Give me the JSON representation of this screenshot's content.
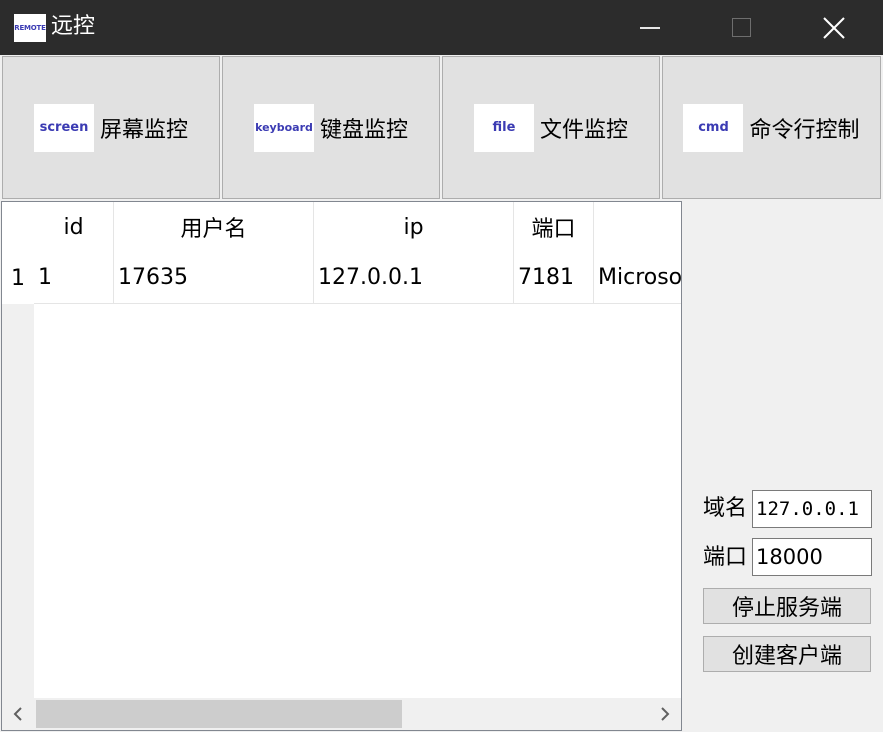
{
  "window": {
    "app_icon_text": "REMOTE",
    "title": "远控",
    "controls": {
      "minimize": "minimize-icon",
      "maximize": "maximize-icon",
      "close": "close-icon"
    }
  },
  "toolbar": {
    "buttons": [
      {
        "icon_text": "screen",
        "label": "屏幕监控"
      },
      {
        "icon_text": "keyboard",
        "label": "键盘监控"
      },
      {
        "icon_text": "file",
        "label": "文件监控"
      },
      {
        "icon_text": "cmd",
        "label": "命令行控制"
      }
    ]
  },
  "table": {
    "columns": [
      "id",
      "用户名",
      "ip",
      "端口",
      ""
    ],
    "rows": [
      {
        "row_number": "1",
        "cells": [
          "1",
          "17635",
          "127.0.0.1",
          "7181",
          "Microsoft"
        ]
      }
    ]
  },
  "panel": {
    "domain_label": "域名",
    "domain_value": "127.0.0.1",
    "port_label": "端口",
    "port_value": "18000",
    "stop_server_label": "停止服务端",
    "create_client_label": "创建客户端"
  },
  "colors": {
    "titlebar": "#2c2c2c",
    "icon_text": "#3b3bb3",
    "button_face": "#e1e1e1",
    "window_bg": "#f0f0f0"
  }
}
